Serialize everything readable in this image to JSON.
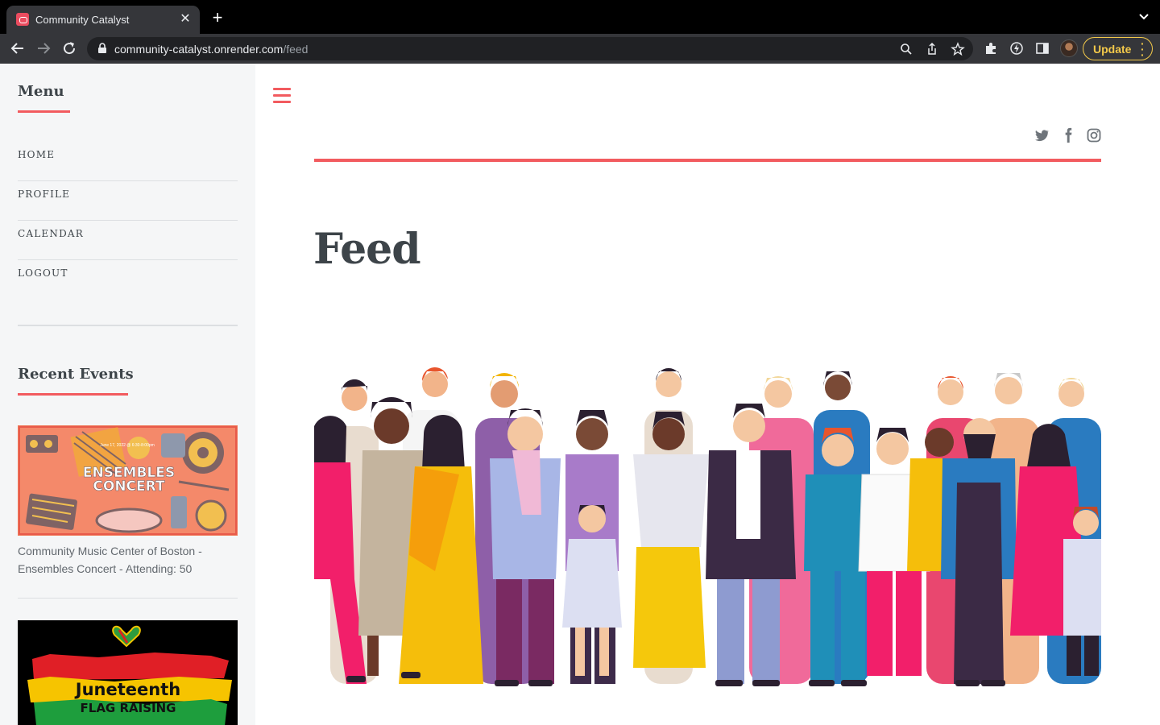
{
  "browser": {
    "tab_title": "Community Catalyst",
    "url_host": "community-catalyst.onrender.com",
    "url_path": "/feed",
    "update_label": "Update"
  },
  "sidebar": {
    "menu_heading": "Menu",
    "menu_items": [
      {
        "label": "HOME"
      },
      {
        "label": "PROFILE"
      },
      {
        "label": "CALENDAR"
      },
      {
        "label": "LOGOUT"
      }
    ],
    "recent_heading": "Recent Events",
    "events": [
      {
        "image_title_line1": "ENSEMBLES",
        "image_title_line2": "CONCERT",
        "image_subtitle": "June 17, 2022 @ 6:30-8:00pm",
        "caption": "Community Music Center of Boston - Ensembles Concert - Attending: 50"
      },
      {
        "image_title_line1": "Juneteenth",
        "image_title_line2": "FLAG RAISING"
      }
    ]
  },
  "main": {
    "page_title": "Feed",
    "social_icons": [
      "twitter-icon",
      "facebook-icon",
      "instagram-icon"
    ]
  },
  "colors": {
    "accent": "#f25b5f",
    "heading": "#3d4449",
    "sidebar_bg": "#f5f6f7"
  }
}
